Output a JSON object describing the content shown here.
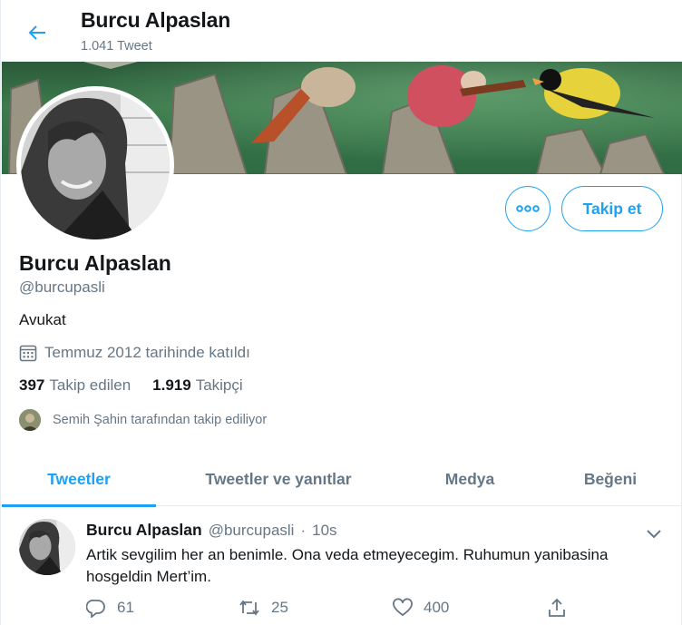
{
  "header": {
    "title": "Burcu Alpaslan",
    "tweet_count": "1.041 Tweet"
  },
  "profile": {
    "follow_label": "Takip et",
    "name": "Burcu Alpaslan",
    "handle": "@burcupasli",
    "bio": "Avukat",
    "joined": "Temmuz 2012 tarihinde katıldı",
    "following_count": "397",
    "following_label": "Takip edilen",
    "followers_count": "1.919",
    "followers_label": "Takipçi",
    "followed_by": "Semih Şahin tarafından takip ediliyor"
  },
  "tabs": [
    {
      "label": "Tweetler",
      "active": true
    },
    {
      "label": "Tweetler ve yanıtlar",
      "active": false
    },
    {
      "label": "Medya",
      "active": false
    },
    {
      "label": "Beğeni",
      "active": false
    }
  ],
  "tweet": {
    "name": "Burcu Alpaslan",
    "handle": "@burcupasli",
    "separator": "·",
    "time": "10s",
    "text": "Artik sevgilim her an benimle. Ona veda etmeyecegim. Ruhumun yanibasina hosgeldin Mert’im.",
    "replies": "61",
    "retweets": "25",
    "likes": "400"
  },
  "colors": {
    "accent": "#1da1f2",
    "secondary_text": "#657786",
    "primary_text": "#14171a"
  }
}
